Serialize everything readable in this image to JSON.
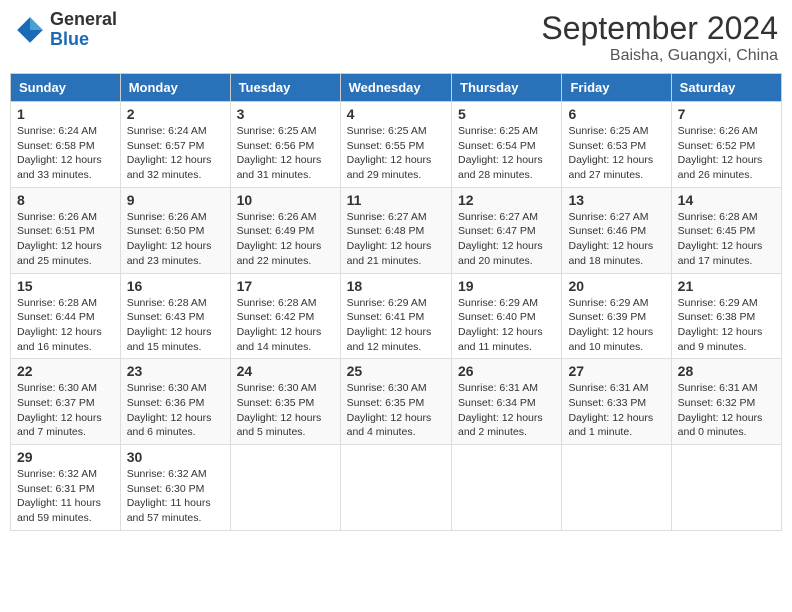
{
  "header": {
    "logo_general": "General",
    "logo_blue": "Blue",
    "month_title": "September 2024",
    "location": "Baisha, Guangxi, China"
  },
  "weekdays": [
    "Sunday",
    "Monday",
    "Tuesday",
    "Wednesday",
    "Thursday",
    "Friday",
    "Saturday"
  ],
  "weeks": [
    [
      {
        "day": "1",
        "sunrise": "6:24 AM",
        "sunset": "6:58 PM",
        "daylight": "12 hours and 33 minutes."
      },
      {
        "day": "2",
        "sunrise": "6:24 AM",
        "sunset": "6:57 PM",
        "daylight": "12 hours and 32 minutes."
      },
      {
        "day": "3",
        "sunrise": "6:25 AM",
        "sunset": "6:56 PM",
        "daylight": "12 hours and 31 minutes."
      },
      {
        "day": "4",
        "sunrise": "6:25 AM",
        "sunset": "6:55 PM",
        "daylight": "12 hours and 29 minutes."
      },
      {
        "day": "5",
        "sunrise": "6:25 AM",
        "sunset": "6:54 PM",
        "daylight": "12 hours and 28 minutes."
      },
      {
        "day": "6",
        "sunrise": "6:25 AM",
        "sunset": "6:53 PM",
        "daylight": "12 hours and 27 minutes."
      },
      {
        "day": "7",
        "sunrise": "6:26 AM",
        "sunset": "6:52 PM",
        "daylight": "12 hours and 26 minutes."
      }
    ],
    [
      {
        "day": "8",
        "sunrise": "6:26 AM",
        "sunset": "6:51 PM",
        "daylight": "12 hours and 25 minutes."
      },
      {
        "day": "9",
        "sunrise": "6:26 AM",
        "sunset": "6:50 PM",
        "daylight": "12 hours and 23 minutes."
      },
      {
        "day": "10",
        "sunrise": "6:26 AM",
        "sunset": "6:49 PM",
        "daylight": "12 hours and 22 minutes."
      },
      {
        "day": "11",
        "sunrise": "6:27 AM",
        "sunset": "6:48 PM",
        "daylight": "12 hours and 21 minutes."
      },
      {
        "day": "12",
        "sunrise": "6:27 AM",
        "sunset": "6:47 PM",
        "daylight": "12 hours and 20 minutes."
      },
      {
        "day": "13",
        "sunrise": "6:27 AM",
        "sunset": "6:46 PM",
        "daylight": "12 hours and 18 minutes."
      },
      {
        "day": "14",
        "sunrise": "6:28 AM",
        "sunset": "6:45 PM",
        "daylight": "12 hours and 17 minutes."
      }
    ],
    [
      {
        "day": "15",
        "sunrise": "6:28 AM",
        "sunset": "6:44 PM",
        "daylight": "12 hours and 16 minutes."
      },
      {
        "day": "16",
        "sunrise": "6:28 AM",
        "sunset": "6:43 PM",
        "daylight": "12 hours and 15 minutes."
      },
      {
        "day": "17",
        "sunrise": "6:28 AM",
        "sunset": "6:42 PM",
        "daylight": "12 hours and 14 minutes."
      },
      {
        "day": "18",
        "sunrise": "6:29 AM",
        "sunset": "6:41 PM",
        "daylight": "12 hours and 12 minutes."
      },
      {
        "day": "19",
        "sunrise": "6:29 AM",
        "sunset": "6:40 PM",
        "daylight": "12 hours and 11 minutes."
      },
      {
        "day": "20",
        "sunrise": "6:29 AM",
        "sunset": "6:39 PM",
        "daylight": "12 hours and 10 minutes."
      },
      {
        "day": "21",
        "sunrise": "6:29 AM",
        "sunset": "6:38 PM",
        "daylight": "12 hours and 9 minutes."
      }
    ],
    [
      {
        "day": "22",
        "sunrise": "6:30 AM",
        "sunset": "6:37 PM",
        "daylight": "12 hours and 7 minutes."
      },
      {
        "day": "23",
        "sunrise": "6:30 AM",
        "sunset": "6:36 PM",
        "daylight": "12 hours and 6 minutes."
      },
      {
        "day": "24",
        "sunrise": "6:30 AM",
        "sunset": "6:35 PM",
        "daylight": "12 hours and 5 minutes."
      },
      {
        "day": "25",
        "sunrise": "6:30 AM",
        "sunset": "6:35 PM",
        "daylight": "12 hours and 4 minutes."
      },
      {
        "day": "26",
        "sunrise": "6:31 AM",
        "sunset": "6:34 PM",
        "daylight": "12 hours and 2 minutes."
      },
      {
        "day": "27",
        "sunrise": "6:31 AM",
        "sunset": "6:33 PM",
        "daylight": "12 hours and 1 minute."
      },
      {
        "day": "28",
        "sunrise": "6:31 AM",
        "sunset": "6:32 PM",
        "daylight": "12 hours and 0 minutes."
      }
    ],
    [
      {
        "day": "29",
        "sunrise": "6:32 AM",
        "sunset": "6:31 PM",
        "daylight": "11 hours and 59 minutes."
      },
      {
        "day": "30",
        "sunrise": "6:32 AM",
        "sunset": "6:30 PM",
        "daylight": "11 hours and 57 minutes."
      },
      null,
      null,
      null,
      null,
      null
    ]
  ]
}
